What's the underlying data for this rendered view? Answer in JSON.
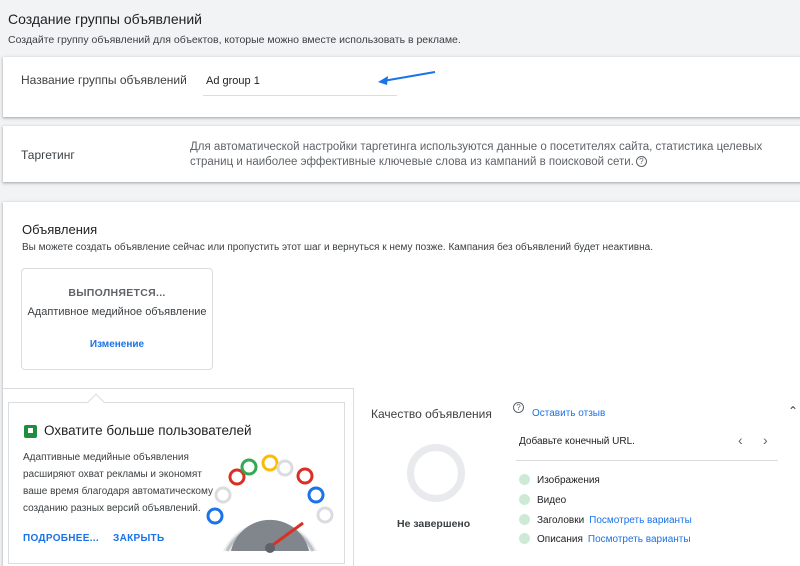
{
  "header": {
    "title": "Создание группы объявлений",
    "subtitle": "Создайте группу объявлений для объектов, которые можно вместе использовать в рекламе."
  },
  "adgroup": {
    "label": "Название группы объявлений",
    "value": "Ad group 1"
  },
  "targeting": {
    "label": "Таргетинг",
    "description": "Для автоматической настройки таргетинга используются данные о посетителях сайта, статистика целевых страниц и наиболее эффективные ключевые слова из кампаний в поисковой сети.",
    "help_icon": "?"
  },
  "ads": {
    "title": "Объявления",
    "subtitle": "Вы можете создать объявление сейчас или пропустить этот шаг и вернуться к нему позже. Кампания без объявлений будет неактивна.",
    "ad_card": {
      "status": "ВЫПОЛНЯЕТСЯ...",
      "name": "Адаптивное медийное объявление",
      "change_link": "Изменение"
    }
  },
  "promo": {
    "title": "Охватите больше пользователей",
    "text": "Адаптивные медийные объявления расширяют охват рекламы и экономят ваше время благодаря автоматическому созданию разных версий объявлений.",
    "more_link": "ПОДРОБНЕЕ...",
    "close_link": "ЗАКРЫТЬ",
    "flag_color": "#1e8e3e"
  },
  "quality": {
    "title": "Качество объявления",
    "help_icon": "?",
    "feedback_link": "Оставить отзыв",
    "status": "Не завершено",
    "message": "Добавьте конечный URL.",
    "items": [
      {
        "label": "Изображения",
        "link": ""
      },
      {
        "label": "Видео",
        "link": ""
      },
      {
        "label": "Заголовки",
        "link": "Посмотреть варианты"
      },
      {
        "label": "Описания",
        "link": "Посмотреть варианты"
      }
    ]
  },
  "colors": {
    "accent": "#1a73e8",
    "arrow": "#1a73e8",
    "item_dot": "#ceead6"
  }
}
